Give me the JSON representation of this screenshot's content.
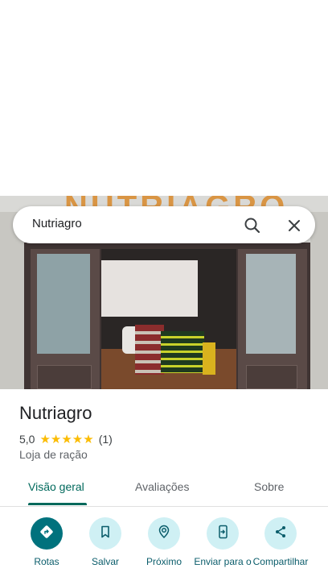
{
  "search": {
    "query": "Nutriagro"
  },
  "place": {
    "name": "Nutriagro",
    "rating": "5,0",
    "stars": "★★★★★",
    "review_count": "(1)",
    "category": "Loja de ração"
  },
  "tabs": [
    {
      "label": "Visão geral",
      "active": true
    },
    {
      "label": "Avaliações"
    },
    {
      "label": "Sobre"
    }
  ],
  "actions": [
    {
      "label": "Rotas",
      "icon": "directions-icon"
    },
    {
      "label": "Salvar",
      "icon": "bookmark-icon"
    },
    {
      "label": "Próximo",
      "icon": "nearby-icon"
    },
    {
      "label": "Enviar para o",
      "icon": "send-to-phone-icon"
    },
    {
      "label": "Compartilhar",
      "icon": "share-icon"
    }
  ],
  "colors": {
    "accent": "#00695c",
    "action_bg": "#cff0f4",
    "primary_action": "#00727d",
    "star": "#fbbc04"
  }
}
